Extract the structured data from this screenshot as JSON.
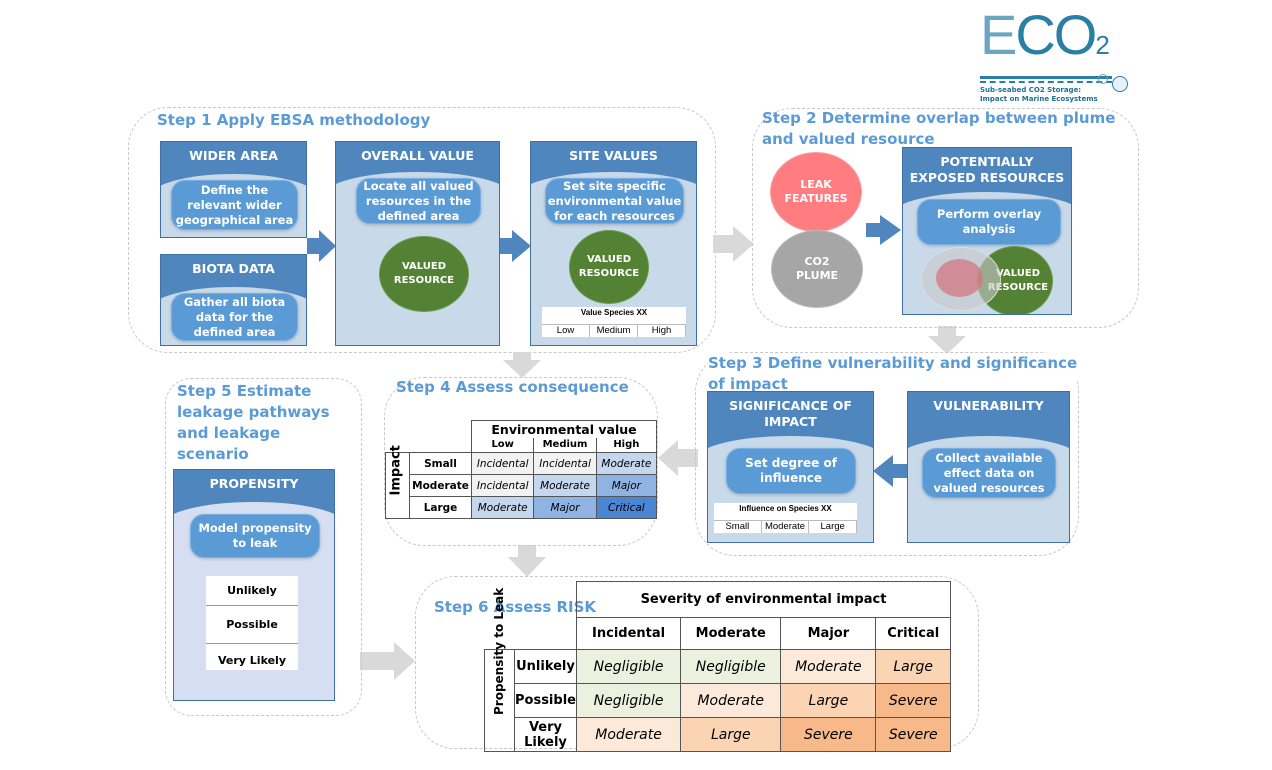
{
  "logo": {
    "text": "ECO2",
    "tagline_1": "Sub-seabed CO2 Storage:",
    "tagline_2": "Impact on Marine Ecosystems"
  },
  "colors": {
    "panel_header": "#4f86bd",
    "panel_body": "#c8d9ea",
    "pill": "#5b9bd5",
    "valued_resource": "#548235",
    "leak": "#ff7c80",
    "plume": "#a6a6a6",
    "step_title": "#5b9bd5"
  },
  "step1": {
    "title": "Step 1 Apply EBSA methodology",
    "wider_area": {
      "header": "WIDER AREA",
      "text": "Define the relevant wider geographical area"
    },
    "biota_data": {
      "header": "BIOTA DATA",
      "text": "Gather all biota data for the defined area"
    },
    "overall_value": {
      "header": "OVERALL VALUE",
      "text": "Locate all valued resources in the defined area",
      "circle": "VALUED RESOURCE"
    },
    "site_values": {
      "header": "SITE VALUES",
      "text": "Set site specific environmental value for each resources",
      "circle": "VALUED RESOURCE",
      "scale_title": "Value Species XX",
      "scale": [
        "Low",
        "Medium",
        "High"
      ]
    }
  },
  "step2": {
    "title_1": "Step 2 Determine overlap between plume",
    "title_2": "and valued resource",
    "leak": "LEAK FEATURES",
    "plume": "CO2 PLUME",
    "exposed": {
      "header": "POTENTIALLY EXPOSED RESOURCES",
      "text": "Perform overlay analysis",
      "circle": "VALUED RESOURCE"
    }
  },
  "step3": {
    "title_1": "Step 3 Define vulnerability and significance",
    "title_2": "of impact",
    "significance": {
      "header": "SIGNIFICANCE OF IMPACT",
      "text": "Set degree of influence",
      "scale_title": "Influence on Species XX",
      "scale": [
        "Small",
        "Moderate",
        "Large"
      ]
    },
    "vulnerability": {
      "header": "VULNERABILITY",
      "text": "Collect available effect data on valued resources"
    }
  },
  "step4": {
    "title": "Step 4 Assess consequence",
    "col_header": "Environmental value",
    "row_header": "Impact",
    "cols": [
      "Low",
      "Medium",
      "High"
    ],
    "rows": [
      {
        "label": "Small",
        "cells": [
          "Incidental",
          "Incidental",
          "Moderate"
        ]
      },
      {
        "label": "Moderate",
        "cells": [
          "Incidental",
          "Moderate",
          "Major"
        ]
      },
      {
        "label": "Large",
        "cells": [
          "Moderate",
          "Major",
          "Critical"
        ]
      }
    ]
  },
  "step5": {
    "title": "Step 5 Estimate leakage pathways and leakage scenario",
    "propensity": {
      "header": "PROPENSITY",
      "text": "Model propensity to leak",
      "levels": [
        "Unlikely",
        "Possible",
        "Very Likely"
      ]
    }
  },
  "step6": {
    "title": "Step 6 Assess RISK",
    "col_header": "Severity of environmental impact",
    "row_header": "Propensity to Leak",
    "cols": [
      "Incidental",
      "Moderate",
      "Major",
      "Critical"
    ],
    "rows": [
      {
        "label": "Unlikely",
        "cells": [
          "Negligible",
          "Negligible",
          "Moderate",
          "Large"
        ]
      },
      {
        "label": "Possible",
        "cells": [
          "Negligible",
          "Moderate",
          "Large",
          "Severe"
        ]
      },
      {
        "label": "Very Likely",
        "cells": [
          "Moderate",
          "Large",
          "Severe",
          "Severe"
        ]
      }
    ]
  }
}
